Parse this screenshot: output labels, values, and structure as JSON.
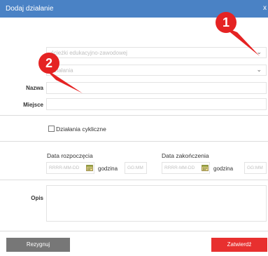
{
  "dialog": {
    "title": "Dodaj działanie",
    "close": "x"
  },
  "selects": [
    {
      "placeholder": "ścieżki edukacyjno-zawodowej"
    },
    {
      "placeholder": "działania"
    }
  ],
  "fields": {
    "name_label": "Nazwa",
    "place_label": "Miejsce",
    "cyclic_label": "Działania cykliczne",
    "start_label": "Data rozpoczęcia",
    "end_label": "Data zakończenia",
    "date_placeholder": "RRRR-MM-DD",
    "hour_label": "godzina",
    "time_placeholder": "GG:MM",
    "desc_label": "Opis"
  },
  "buttons": {
    "cancel": "Rezygnuj",
    "confirm": "Zatwierdź"
  },
  "annotations": [
    {
      "number": "1"
    },
    {
      "number": "2"
    }
  ],
  "colors": {
    "titlebar": "#4a82c5",
    "confirm": "#e8302f",
    "cancel": "#777777",
    "annotation": "#e52323"
  }
}
